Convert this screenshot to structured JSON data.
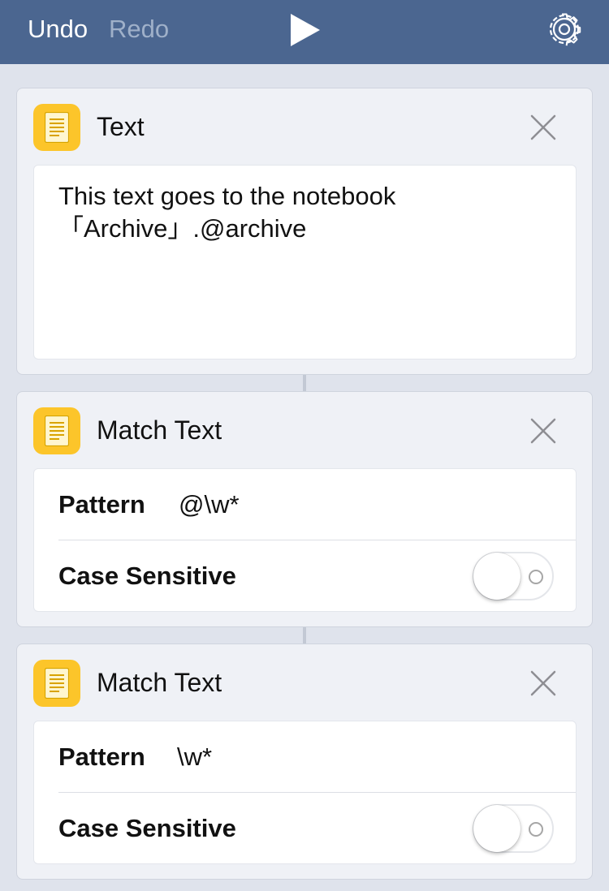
{
  "toolbar": {
    "undo_label": "Undo",
    "redo_label": "Redo",
    "play_icon": "play-icon",
    "settings_icon": "gear-icon"
  },
  "colors": {
    "toolbar_bg": "#4b6690",
    "background": "#dfe3ec",
    "card_bg": "#eff1f6",
    "icon_yellow": "#fcc52a",
    "redo_disabled": "#9fb0c9"
  },
  "actions": [
    {
      "title": "Text",
      "icon": "document-icon",
      "text": "This text goes to the notebook 「Archive」.@archive"
    },
    {
      "title": "Match Text",
      "icon": "document-icon",
      "pattern_label": "Pattern",
      "pattern_value": "@\\w*",
      "case_label": "Case Sensitive",
      "case_sensitive": false
    },
    {
      "title": "Match Text",
      "icon": "document-icon",
      "pattern_label": "Pattern",
      "pattern_value": "\\w*",
      "case_label": "Case Sensitive",
      "case_sensitive": false
    }
  ]
}
